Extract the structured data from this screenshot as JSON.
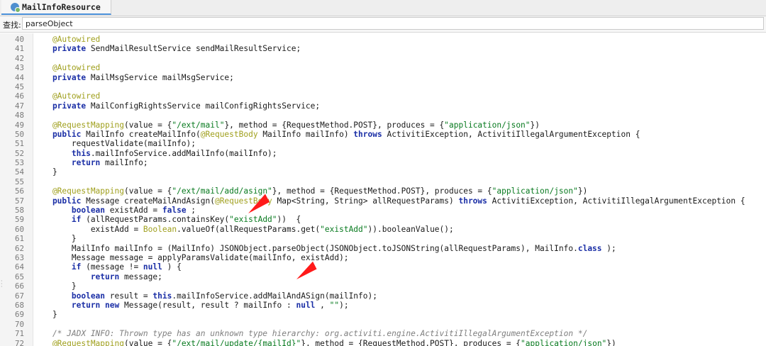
{
  "tab": {
    "icon": "class-file-icon",
    "title": "MailInfoResource"
  },
  "search": {
    "label": "查找:",
    "value": "parseObject"
  },
  "editor": {
    "lines": [
      {
        "n": "40",
        "t": [
          [
            "an",
            "    @Autowired"
          ]
        ]
      },
      {
        "n": "41",
        "t": [
          [
            "kw",
            "    private"
          ],
          [
            "",
            "SendMailResultService sendMailResultService;",
            " "
          ]
        ]
      },
      {
        "n": "42",
        "t": []
      },
      {
        "n": "43",
        "t": [
          [
            "an",
            "    @Autowired"
          ]
        ]
      },
      {
        "n": "44",
        "t": [
          [
            "kw",
            "    private"
          ],
          [
            "",
            " MailMsgService mailMsgService;"
          ]
        ]
      },
      {
        "n": "45",
        "t": []
      },
      {
        "n": "46",
        "t": [
          [
            "an",
            "    @Autowired"
          ]
        ]
      },
      {
        "n": "47",
        "t": [
          [
            "kw",
            "    private"
          ],
          [
            "",
            " MailConfigRightsService mailConfigRightsService;"
          ]
        ]
      },
      {
        "n": "48",
        "t": []
      },
      {
        "n": "49",
        "t": [
          [
            "an",
            "    @RequestMapping"
          ],
          [
            "",
            "(value = {"
          ],
          [
            "st",
            "\"/ext/mail\""
          ],
          [
            "",
            "}, method = {RequestMethod.POST}, produces = {"
          ],
          [
            "st",
            "\"application/json\""
          ],
          [
            "",
            "})"
          ]
        ]
      },
      {
        "n": "50",
        "t": [
          [
            "kw",
            "    public"
          ],
          [
            "",
            " MailInfo createMailInfo("
          ],
          [
            "an",
            "@RequestBody"
          ],
          [
            "",
            " MailInfo mailInfo) "
          ],
          [
            "kw",
            "throws"
          ],
          [
            "",
            " ActivitiException, ActivitiIllegalArgumentException {"
          ]
        ]
      },
      {
        "n": "51",
        "t": [
          [
            "",
            "        requestValidate(mailInfo);"
          ]
        ]
      },
      {
        "n": "52",
        "t": [
          [
            "kw",
            "        this"
          ],
          [
            "",
            ".mailInfoService.addMailInfo(mailInfo);"
          ]
        ]
      },
      {
        "n": "53",
        "t": [
          [
            "kw",
            "        return"
          ],
          [
            "",
            " mailInfo;"
          ]
        ]
      },
      {
        "n": "54",
        "t": [
          [
            "",
            "    }"
          ]
        ]
      },
      {
        "n": "55",
        "t": []
      },
      {
        "n": "56",
        "t": [
          [
            "an",
            "    @RequestMapping"
          ],
          [
            "",
            "(value = {"
          ],
          [
            "st",
            "\"/ext/mail/add/asign\""
          ],
          [
            "",
            "}, method = {RequestMethod.POST}, produces = {"
          ],
          [
            "st",
            "\"application/json\""
          ],
          [
            "",
            "})"
          ]
        ]
      },
      {
        "n": "57",
        "t": [
          [
            "kw",
            "    public"
          ],
          [
            "",
            " Message createMailAndAsign("
          ],
          [
            "an",
            "@RequestBody"
          ],
          [
            "",
            " Map<String, String> allRequestParams) "
          ],
          [
            "kw",
            "throws"
          ],
          [
            "",
            " ActivitiException, ActivitiIllegalArgumentException {"
          ]
        ]
      },
      {
        "n": "58",
        "t": [
          [
            "kw",
            "        boolean"
          ],
          [
            "",
            " existAdd = "
          ],
          [
            "kw",
            "false"
          ],
          [
            "",
            ";"
          ]
        ]
      },
      {
        "n": "59",
        "t": [
          [
            "kw",
            "        if"
          ],
          [
            "",
            " (allRequestParams.containsKey("
          ],
          [
            "st",
            "\"existAdd\""
          ],
          [
            "",
            "))  {"
          ]
        ]
      },
      {
        "n": "60",
        "t": [
          [
            "",
            "            existAdd = "
          ],
          [
            "an",
            "Boolean"
          ],
          [
            "",
            ".valueOf(allRequestParams.get("
          ],
          [
            "st",
            "\"existAdd\""
          ],
          [
            "",
            ")).booleanValue();"
          ]
        ]
      },
      {
        "n": "61",
        "t": [
          [
            "",
            "        }"
          ]
        ]
      },
      {
        "n": "62",
        "t": [
          [
            "",
            "        MailInfo mailInfo = (MailInfo) JSONObject.parseObject(JSONObject.toJSONString(allRequestParams), MailInfo."
          ],
          [
            "kw",
            "class"
          ],
          [
            "",
            ");"
          ]
        ]
      },
      {
        "n": "63",
        "t": [
          [
            "",
            "        Message message = applyParamsValidate(mailInfo, existAdd);"
          ]
        ]
      },
      {
        "n": "64",
        "t": [
          [
            "kw",
            "        if"
          ],
          [
            "",
            " (message != "
          ],
          [
            "kw",
            "null"
          ],
          [
            "",
            ") {"
          ]
        ]
      },
      {
        "n": "65",
        "t": [
          [
            "kw",
            "            return"
          ],
          [
            "",
            " message;"
          ]
        ]
      },
      {
        "n": "66",
        "t": [
          [
            "",
            "        }"
          ]
        ]
      },
      {
        "n": "67",
        "t": [
          [
            "kw",
            "        boolean"
          ],
          [
            "",
            " result = "
          ],
          [
            "kw",
            "this"
          ],
          [
            "",
            ".mailInfoService.addMailAndASign(mailInfo);"
          ]
        ]
      },
      {
        "n": "68",
        "t": [
          [
            "kw",
            "        return new"
          ],
          [
            "",
            " Message(result, result ? mailInfo : "
          ],
          [
            "kw",
            "null"
          ],
          [
            "",
            ", "
          ],
          [
            "st",
            "\"\""
          ],
          [
            "",
            ");"
          ]
        ]
      },
      {
        "n": "69",
        "t": [
          [
            "",
            "    }"
          ]
        ]
      },
      {
        "n": "70",
        "t": []
      },
      {
        "n": "71",
        "t": [
          [
            "cm",
            "    /* JADX INFO: Thrown type has an unknown type hierarchy: org.activiti.engine.ActivitiIllegalArgumentException */"
          ]
        ]
      },
      {
        "n": "72",
        "t": [
          [
            "an",
            "    @RequestMapping"
          ],
          [
            "",
            "(value = {"
          ],
          [
            "st",
            "\"/ext/mail/update/{mailId}\""
          ],
          [
            "",
            "}, method = {RequestMethod.POST}, produces = {"
          ],
          [
            "st",
            "\"application/json\""
          ],
          [
            "",
            "})"
          ]
        ]
      }
    ]
  },
  "colors": {
    "keyword": "#1b2fa6",
    "annotation": "#a0a01e",
    "string": "#087a1f",
    "comment": "#7f7f7f",
    "arrow": "#ff1a1a"
  }
}
